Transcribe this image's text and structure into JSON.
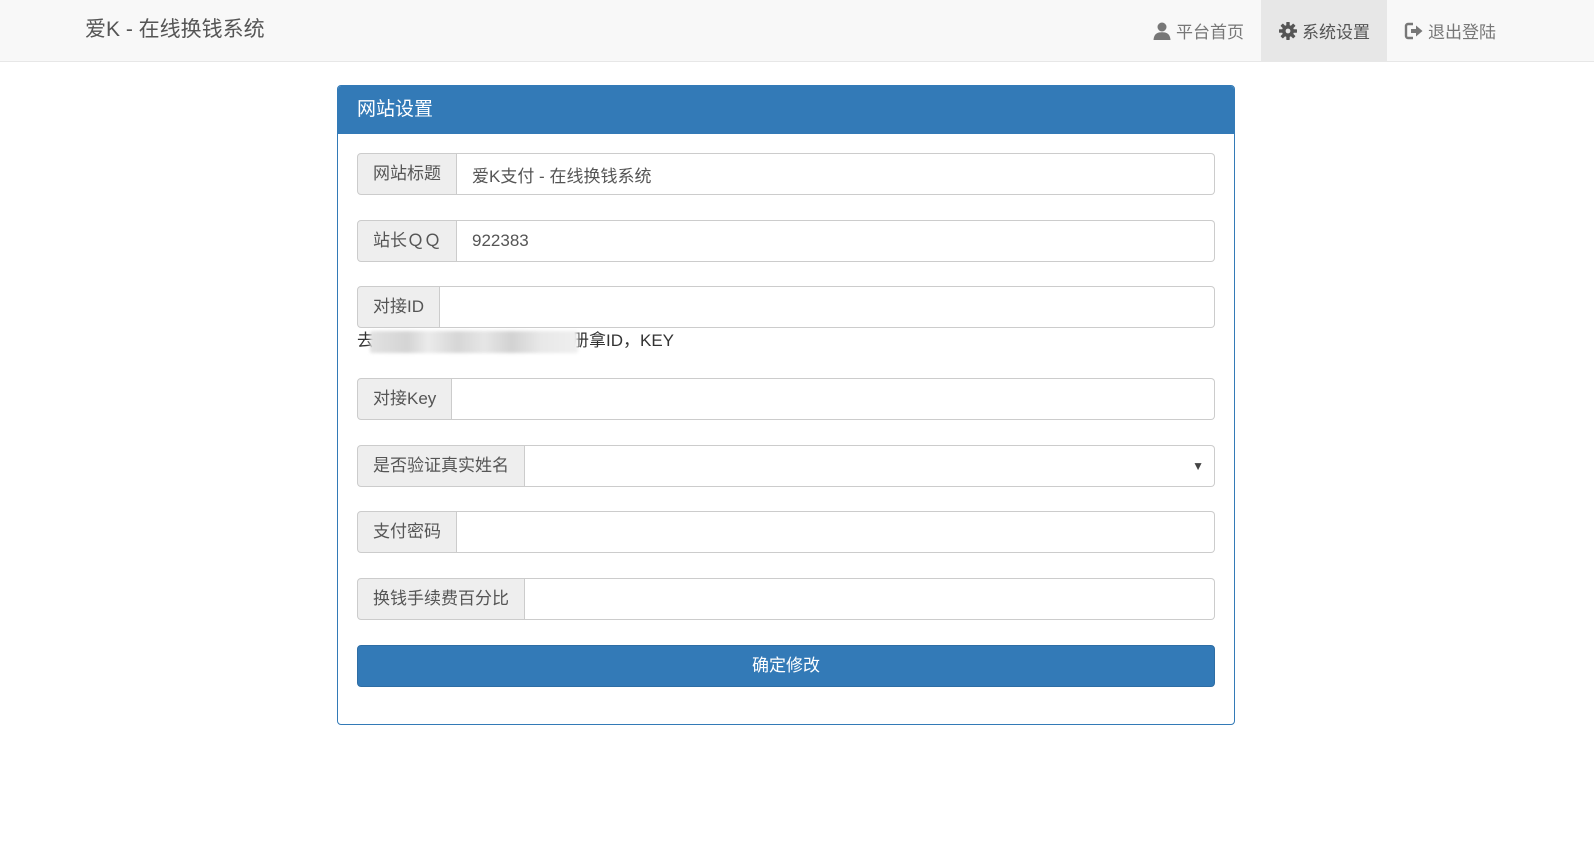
{
  "navbar": {
    "brand": "爱K - 在线换钱系统",
    "items": [
      {
        "label": "平台首页",
        "icon": "user-icon",
        "active": false
      },
      {
        "label": "系统设置",
        "icon": "gear-icon",
        "active": true
      },
      {
        "label": "退出登陆",
        "icon": "logout-icon",
        "active": false
      }
    ]
  },
  "panel": {
    "title": "网站设置",
    "fields": {
      "site_title": {
        "label": "网站标题",
        "value": "爱K支付 - 在线换钱系统"
      },
      "qq": {
        "label": "站长ＱＱ",
        "value": "922383"
      },
      "api_id": {
        "label": "对接ID",
        "value": ""
      },
      "api_key": {
        "label": "对接Key",
        "value": ""
      },
      "verify_realname": {
        "label": "是否验证真实姓名",
        "value": ""
      },
      "pay_password": {
        "label": "支付密码",
        "value": ""
      },
      "fee_percent": {
        "label": "换钱手续费百分比",
        "value": ""
      }
    },
    "help_text": {
      "prefix": "去",
      "suffix": "册拿ID，KEY"
    },
    "submit_label": "确定修改"
  },
  "colors": {
    "primary": "#337ab7",
    "navbar_bg": "#f8f8f8",
    "addon_bg": "#eeeeee"
  }
}
